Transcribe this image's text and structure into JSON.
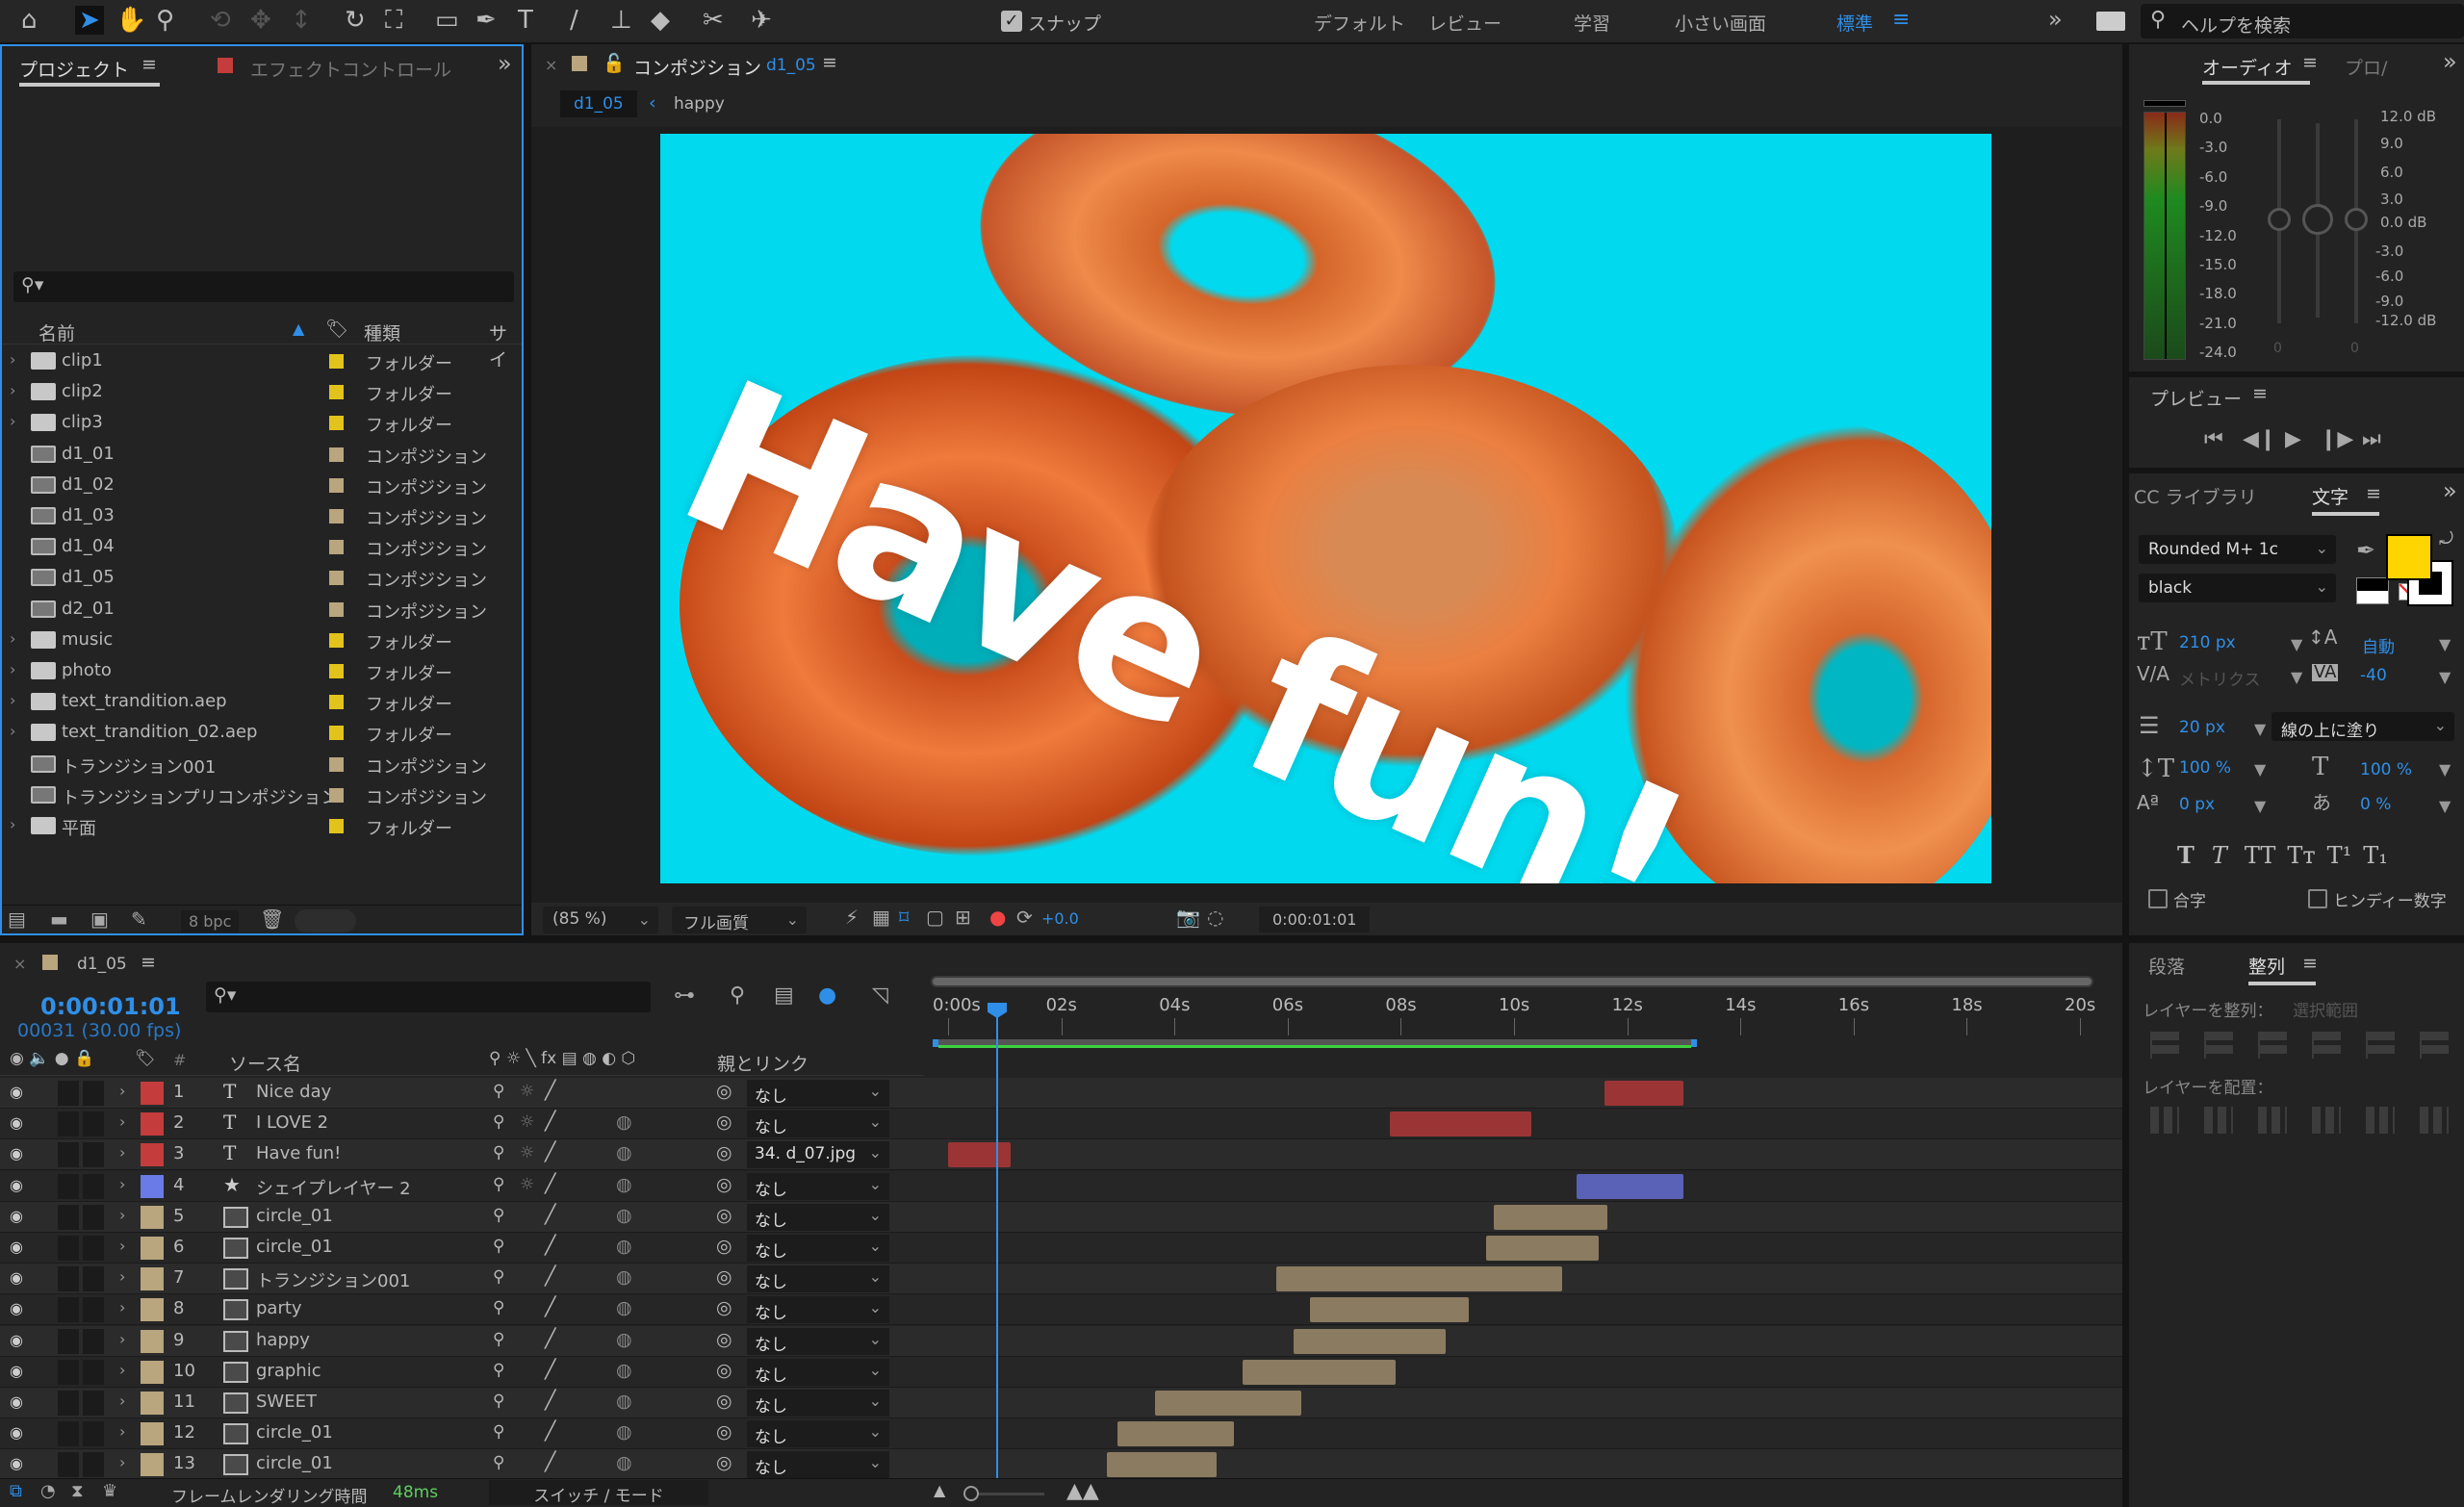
{
  "colors": {
    "accent": "#2f8fe8",
    "folder_label": "#e2c31c",
    "comp_label": "#b9a57e",
    "red_label": "#c43c3c",
    "blue_label": "#6a7ae6",
    "fill_color": "#ffd500",
    "stroke_color": "#ffffff",
    "viewer_bg": "#00d9ee",
    "work_area": "#3fd13f"
  },
  "toolbar": {
    "tools": [
      "home-icon",
      "selection-tool-icon",
      "hand-tool-icon",
      "zoom-tool-icon",
      "orbit-camera-icon",
      "pan-camera-icon",
      "dolly-camera-icon",
      "rotate-tool-icon",
      "anchor-point-tool-icon",
      "rectangle-tool-icon",
      "pen-tool-icon",
      "type-tool-icon",
      "brush-tool-icon",
      "clone-stamp-icon",
      "eraser-icon",
      "roto-brush-icon",
      "puppet-pin-icon"
    ],
    "snap_label": "スナップ",
    "workspaces": [
      "デフォルト",
      "レビュー",
      "学習",
      "小さい画面",
      "標準"
    ],
    "active_workspace": "標準",
    "search_placeholder": "ヘルプを検索"
  },
  "project": {
    "tab_project": "プロジェクト",
    "tab_effects": "エフェクトコントロール",
    "col_name": "名前",
    "col_type": "種類",
    "col_size": "サイ",
    "bpc": "8 bpc",
    "items": [
      {
        "name": "clip1",
        "type": "フォルダー",
        "kind": "folder"
      },
      {
        "name": "clip2",
        "type": "フォルダー",
        "kind": "folder"
      },
      {
        "name": "clip3",
        "type": "フォルダー",
        "kind": "folder"
      },
      {
        "name": "d1_01",
        "type": "コンポジション",
        "kind": "comp"
      },
      {
        "name": "d1_02",
        "type": "コンポジション",
        "kind": "comp"
      },
      {
        "name": "d1_03",
        "type": "コンポジション",
        "kind": "comp"
      },
      {
        "name": "d1_04",
        "type": "コンポジション",
        "kind": "comp"
      },
      {
        "name": "d1_05",
        "type": "コンポジション",
        "kind": "comp"
      },
      {
        "name": "d2_01",
        "type": "コンポジション",
        "kind": "comp"
      },
      {
        "name": "music",
        "type": "フォルダー",
        "kind": "folder"
      },
      {
        "name": "photo",
        "type": "フォルダー",
        "kind": "folder"
      },
      {
        "name": "text_trandition.aep",
        "type": "フォルダー",
        "kind": "folder"
      },
      {
        "name": "text_trandition_02.aep",
        "type": "フォルダー",
        "kind": "folder"
      },
      {
        "name": "トランジション001",
        "type": "コンポジション",
        "kind": "comp"
      },
      {
        "name": "トランジションプリコンポジション",
        "type": "コンポジション",
        "kind": "comp"
      },
      {
        "name": "平面",
        "type": "フォルダー",
        "kind": "folder"
      }
    ]
  },
  "composition": {
    "tab_label": "コンポジション",
    "comp_name": "d1_05",
    "breadcrumb": [
      "d1_05",
      "happy"
    ],
    "overlay_text": "Have fun!",
    "zoom": "(85 %)",
    "quality": "フル画質",
    "exposure": "+0.0",
    "timecode": "0:00:01:01"
  },
  "audio": {
    "tab": "オーディオ",
    "tab2": "プロ/",
    "left_scale": [
      "0.0",
      "-3.0",
      "-6.0",
      "-9.0",
      "-12.0",
      "-15.0",
      "-18.0",
      "-21.0",
      "-24.0"
    ],
    "right_scale": [
      "12.0 dB",
      "9.0",
      "6.0",
      "3.0",
      "0.0 dB",
      "-3.0",
      "-6.0",
      "-9.0",
      "-12.0 dB"
    ],
    "slider_left": "0",
    "slider_right": "0"
  },
  "preview": {
    "title": "プレビュー"
  },
  "character": {
    "tab_cc": "CC ライブラリ",
    "tab": "文字",
    "font": "Rounded M+ 1c",
    "style": "black",
    "size": "210 px",
    "leading": "自動",
    "kerning": "メトリクス",
    "tracking": "-40",
    "stroke_width": "20 px",
    "stroke_mode": "線の上に塗り",
    "vscale": "100 %",
    "hscale": "100 %",
    "baseline": "0 px",
    "tsume": "0 %",
    "ligature": "合字",
    "hindi_digits": "ヒンディー数字"
  },
  "align": {
    "tab_para": "段落",
    "tab": "整列",
    "align_label": "レイヤーを整列：",
    "align_to": "選択範囲",
    "distribute_label": "レイヤーを配置："
  },
  "timeline": {
    "tab": "d1_05",
    "timecode": "0:00:01:01",
    "frames": "00031 (30.00 fps)",
    "col_num": "#",
    "col_source": "ソース名",
    "col_parent": "親とリンク",
    "ruler": [
      "0:00s",
      "02s",
      "04s",
      "06s",
      "08s",
      "10s",
      "12s",
      "14s",
      "16s",
      "18s",
      "20s"
    ],
    "duration_s": 20,
    "current_time_s": 1.03,
    "work_area_end_s": 13.2,
    "render_label": "フレームレンダリング時間",
    "render_time": "48ms",
    "switch_mode": "スイッチ / モード",
    "layers": [
      {
        "num": "1",
        "type": "text",
        "name": "Nice day",
        "label": "red",
        "parent": "なし",
        "in": 11.6,
        "out": 13.0
      },
      {
        "num": "2",
        "type": "text",
        "name": "I LOVE 2",
        "label": "red",
        "parent": "なし",
        "in": 7.8,
        "out": 10.3
      },
      {
        "num": "3",
        "type": "text",
        "name": "Have fun!",
        "label": "red",
        "parent": "34. d_07.jpg",
        "in": 0,
        "out": 1.1
      },
      {
        "num": "4",
        "type": "shape",
        "name": "シェイプレイヤー 2",
        "label": "blue",
        "parent": "なし",
        "in": 11.1,
        "out": 13.0
      },
      {
        "num": "5",
        "type": "comp",
        "name": "circle_01",
        "label": "tan",
        "parent": "なし",
        "in": 9.65,
        "out": 11.65
      },
      {
        "num": "6",
        "type": "comp",
        "name": "circle_01",
        "label": "tan",
        "parent": "なし",
        "in": 9.5,
        "out": 11.5
      },
      {
        "num": "7",
        "type": "comp",
        "name": "トランジション001",
        "label": "tan",
        "parent": "なし",
        "in": 5.8,
        "out": 10.85
      },
      {
        "num": "8",
        "type": "comp",
        "name": "party",
        "label": "tan",
        "parent": "なし",
        "in": 6.4,
        "out": 9.2
      },
      {
        "num": "9",
        "type": "comp",
        "name": "happy",
        "label": "tan",
        "parent": "なし",
        "in": 6.1,
        "out": 8.8
      },
      {
        "num": "10",
        "type": "comp",
        "name": "graphic",
        "label": "tan",
        "parent": "なし",
        "in": 5.2,
        "out": 7.9
      },
      {
        "num": "11",
        "type": "comp",
        "name": "SWEET",
        "label": "tan",
        "parent": "なし",
        "in": 3.65,
        "out": 6.25
      },
      {
        "num": "12",
        "type": "comp",
        "name": "circle_01",
        "label": "tan",
        "parent": "なし",
        "in": 3.0,
        "out": 5.05
      },
      {
        "num": "13",
        "type": "comp",
        "name": "circle_01",
        "label": "tan",
        "parent": "なし",
        "in": 2.8,
        "out": 4.75
      }
    ]
  }
}
